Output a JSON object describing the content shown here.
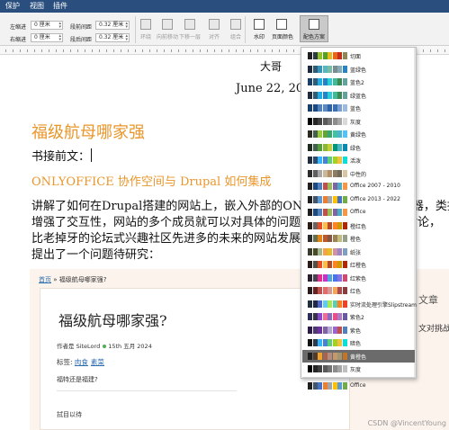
{
  "menubar": {
    "items": [
      "保护",
      "视图",
      "插件"
    ]
  },
  "ribbon": {
    "indent_left_label": "左缩进",
    "indent_left_value": "0 厘米",
    "indent_right_label": "右缩进",
    "indent_right_value": "0 厘米",
    "spacing_before_label": "段前间距",
    "spacing_before_value": "0.32 厘米",
    "spacing_after_label": "段后间距",
    "spacing_after_value": "0.32 厘米",
    "buttons": [
      "环绕",
      "向前移动",
      "下移一层",
      "对齐",
      "组合",
      "水印",
      "页面颜色",
      "配色方案"
    ]
  },
  "document": {
    "author": "大哥",
    "date": "June 22, 2024",
    "title": "福级航母哪家强",
    "lead": "书接前文：",
    "subtitle": "ONLYOFFICE 协作空间与 Drupal 如何集成",
    "para_lines": [
      "讲解了如何在Drupal搭建的网站上，嵌入外部的ONLYOFFICE文档编辑器，类拟器，",
      "增强了交互性，网站的多个成员就可以对具体的问题在线协作讨论，在线讨论，",
      "比老掉牙的论坛式兴趣社区先进多的未来的网站发展方向，本文中我在示",
      "提出了一个问题待研究："
    ]
  },
  "web": {
    "crumb_home": "首页",
    "crumb_rest": " » 福级航母哪家强?",
    "card_title": "福级航母哪家强?",
    "meta_author": "作者是 SiteLord",
    "meta_date": "15th 五月 2024",
    "tags_label": "标签:",
    "tags": [
      "肉食",
      "素菜"
    ],
    "question": "福特还是福建?",
    "try_text": "拭目以待",
    "side_heading": "文章",
    "side_text": "文对挑战",
    "watermark": "CSDN @VincentYoung"
  },
  "color_schemes": {
    "selected": "黄橙色",
    "items": [
      {
        "name": "Office",
        "colors": [
          "#1f1f1f",
          "#44546a",
          "#4472c4",
          "#ed7d31",
          "#a5a5a5",
          "#ffc000",
          "#5b9bd5",
          "#70ad47"
        ]
      },
      {
        "name": "灰度",
        "colors": [
          "#000000",
          "#262626",
          "#404040",
          "#595959",
          "#737373",
          "#8c8c8c",
          "#a6a6a6",
          "#bfbfbf"
        ]
      },
      {
        "name": "黄橙色",
        "colors": [
          "#1f1f1f",
          "#4e3b30",
          "#f0a22e",
          "#a5644e",
          "#b58b80",
          "#c3986d",
          "#a19574",
          "#c17529"
        ]
      },
      {
        "name": "暗色",
        "colors": [
          "#111111",
          "#2d3b4a",
          "#31b6fd",
          "#4584d3",
          "#5bd078",
          "#a5d028",
          "#f5c040",
          "#05e0db"
        ]
      },
      {
        "name": "紫色",
        "colors": [
          "#2e1a47",
          "#4e3a6e",
          "#7030a0",
          "#8064a2",
          "#b4a7d6",
          "#9966cc",
          "#c0504d",
          "#4f81bd"
        ]
      },
      {
        "name": "紫色2",
        "colors": [
          "#2c2c54",
          "#373545",
          "#8b48cf",
          "#f06a9c",
          "#8a6bbf",
          "#e84c8b",
          "#a97cc3",
          "#6b58a5"
        ]
      },
      {
        "name": "实时流处理引擎Slipstream",
        "colors": [
          "#1f2d3d",
          "#212745",
          "#4e67c8",
          "#5eccf3",
          "#a7ea52",
          "#5dceaf",
          "#ff8021",
          "#f14124"
        ]
      },
      {
        "name": "红色",
        "colors": [
          "#2a1a1a",
          "#632423",
          "#c0504d",
          "#e56b6b",
          "#d99694",
          "#f2a65a",
          "#ab4b4b",
          "#8c3b3b"
        ]
      },
      {
        "name": "红紫色",
        "colors": [
          "#2a1d2e",
          "#454551",
          "#e32d91",
          "#c830cc",
          "#4ea6dc",
          "#4775e7",
          "#8971e1",
          "#d54773"
        ]
      },
      {
        "name": "红橙色",
        "colors": [
          "#2b1b17",
          "#505046",
          "#e84c22",
          "#ffbd47",
          "#b64926",
          "#ff8427",
          "#cc9900",
          "#b22600"
        ]
      },
      {
        "name": "纸张",
        "colors": [
          "#3a3a2a",
          "#444d26",
          "#a5b592",
          "#f3a447",
          "#e7bc29",
          "#d092a7",
          "#9c85c0",
          "#809ec2"
        ]
      },
      {
        "name": "橙色",
        "colors": [
          "#2b2b2b",
          "#637052",
          "#e48312",
          "#bd582c",
          "#865640",
          "#9b8357",
          "#c2bc80",
          "#94a088"
        ]
      },
      {
        "name": "橙红色",
        "colors": [
          "#2b1a12",
          "#696464",
          "#e84c22",
          "#ffbd47",
          "#b64926",
          "#ff8427",
          "#cc9900",
          "#b22600"
        ]
      },
      {
        "name": "Office",
        "colors": [
          "#1f1f1f",
          "#1f497d",
          "#4f81bd",
          "#c0504d",
          "#9bbb59",
          "#8064a2",
          "#4bacc6",
          "#f79646"
        ]
      },
      {
        "name": "Office 2013 - 2022",
        "colors": [
          "#1f1f1f",
          "#44546a",
          "#5b9bd5",
          "#ed7d31",
          "#a5a5a5",
          "#ffc000",
          "#4472c4",
          "#70ad47"
        ]
      },
      {
        "name": "Office 2007 - 2010",
        "colors": [
          "#1f1f1f",
          "#1f497d",
          "#4f81bd",
          "#c0504d",
          "#9bbb59",
          "#8064a2",
          "#4bacc6",
          "#f79646"
        ]
      },
      {
        "name": "中性的",
        "colors": [
          "#2b2b2b",
          "#5f5f5f",
          "#a6a6a6",
          "#c9b99a",
          "#b08f6a",
          "#8c7b65",
          "#736a5a",
          "#d9c5a3"
        ]
      },
      {
        "name": "活泼",
        "colors": [
          "#1f2d3d",
          "#2e4b6b",
          "#31b6fd",
          "#4584d3",
          "#5bd078",
          "#a5d028",
          "#f5c040",
          "#05e0db"
        ]
      },
      {
        "name": "绿色",
        "colors": [
          "#1d2b1d",
          "#455f51",
          "#549e39",
          "#8ab833",
          "#c0cf3a",
          "#029676",
          "#4ab5c4",
          "#0989b1"
        ]
      },
      {
        "name": "黄绿色",
        "colors": [
          "#2b2b1d",
          "#455f51",
          "#99cb38",
          "#63a537",
          "#37a76f",
          "#44c1a3",
          "#4eb3cf",
          "#51c3f9"
        ]
      },
      {
        "name": "灰度",
        "colors": [
          "#000000",
          "#262626",
          "#404040",
          "#595959",
          "#737373",
          "#8c8c8c",
          "#a6a6a6",
          "#d9d9d9"
        ]
      },
      {
        "name": "蓝色",
        "colors": [
          "#17406d",
          "#1f497d",
          "#4f81bd",
          "#5a8ac6",
          "#2c63a8",
          "#3c6fb4",
          "#7ba0cd",
          "#9dbbe0"
        ]
      },
      {
        "name": "绿蓝色",
        "colors": [
          "#1d2b3d",
          "#335b74",
          "#1cade4",
          "#2683c6",
          "#27ced7",
          "#42ba97",
          "#3e8853",
          "#62a39f"
        ]
      },
      {
        "name": "蓝色2",
        "colors": [
          "#17406d",
          "#335b74",
          "#1cade4",
          "#2683c6",
          "#27ced7",
          "#42ba97",
          "#3e8853",
          "#62a39f"
        ]
      },
      {
        "name": "蓝绿色",
        "colors": [
          "#1d2b3d",
          "#335b74",
          "#3494ba",
          "#58b6c0",
          "#75bda7",
          "#7a8c8e",
          "#84acb6",
          "#2683c6"
        ]
      },
      {
        "name": "切面",
        "colors": [
          "#1f1f1f",
          "#2c3c43",
          "#90c226",
          "#54a021",
          "#e6b91e",
          "#e76618",
          "#c42f1a",
          "#918655"
        ]
      }
    ]
  }
}
